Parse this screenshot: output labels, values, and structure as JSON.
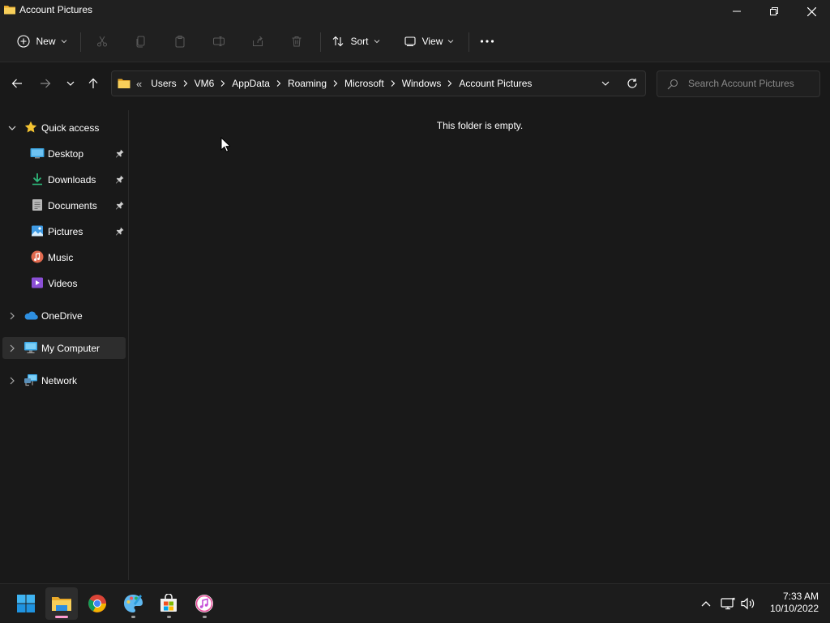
{
  "window": {
    "title": "Account Pictures"
  },
  "toolbar": {
    "new_label": "New",
    "sort_label": "Sort",
    "view_label": "View"
  },
  "address": {
    "crumbs": [
      "Users",
      "VM6",
      "AppData",
      "Roaming",
      "Microsoft",
      "Windows",
      "Account Pictures"
    ]
  },
  "search": {
    "placeholder": "Search Account Pictures"
  },
  "sidebar": {
    "quick_access": "Quick access",
    "items": [
      {
        "label": "Desktop",
        "pinned": true
      },
      {
        "label": "Downloads",
        "pinned": true
      },
      {
        "label": "Documents",
        "pinned": true
      },
      {
        "label": "Pictures",
        "pinned": true
      },
      {
        "label": "Music",
        "pinned": false
      },
      {
        "label": "Videos",
        "pinned": false
      }
    ],
    "onedrive": "OneDrive",
    "my_computer": "My Computer",
    "network": "Network"
  },
  "content": {
    "empty_message": "This folder is empty."
  },
  "taskbar": {
    "apps": [
      "start-icon",
      "file-explorer-icon",
      "chrome-icon",
      "paint-icon",
      "store-icon",
      "itunes-icon"
    ],
    "time": "7:33 AM",
    "date": "10/10/2022"
  },
  "colors": {
    "accent": "#0078d4",
    "folder": "#f5c54a",
    "background": "#191919"
  }
}
